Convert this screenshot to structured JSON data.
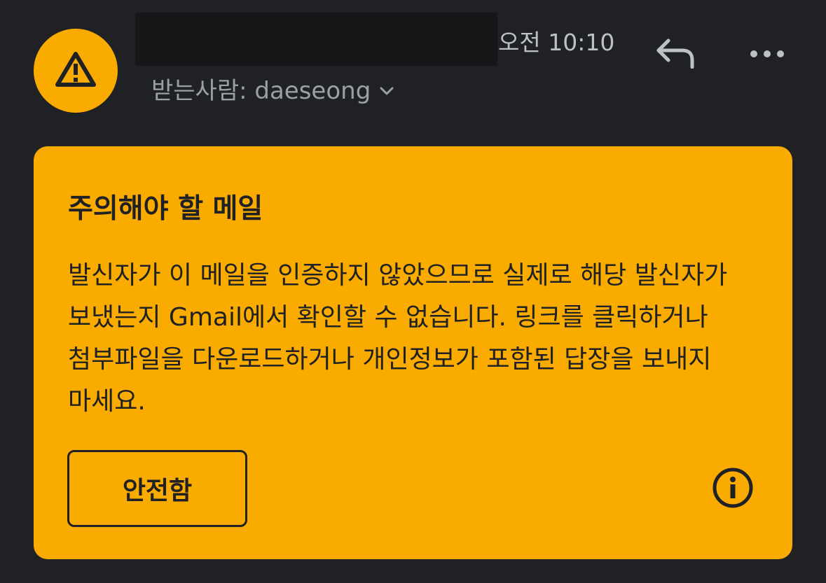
{
  "header": {
    "time": "오전 10:10",
    "recipient_label": "받는사람: daeseong"
  },
  "icons": {
    "avatar": "warning-triangle-icon",
    "reply": "reply-icon",
    "more": "more-horizontal-icon",
    "recipient_expand": "chevron-down-icon",
    "info": "info-icon"
  },
  "warning": {
    "title": "주의해야 할 메일",
    "body": "발신자가 이 메일을 인증하지 않았으므로 실제로 해당 발신자가 보냈는지 Gmail에서 확인할 수 없습니다. 링크를 클릭하거나 첨부파일을 다운로드하거나 개인정보가 포함된 답장을 보내지 마세요.",
    "safe_button_label": "안전함"
  },
  "colors": {
    "background": "#202124",
    "warning": "#f9ab00",
    "text_dark": "#202124",
    "text_muted": "#9aa0a6",
    "redaction": "#161718"
  }
}
